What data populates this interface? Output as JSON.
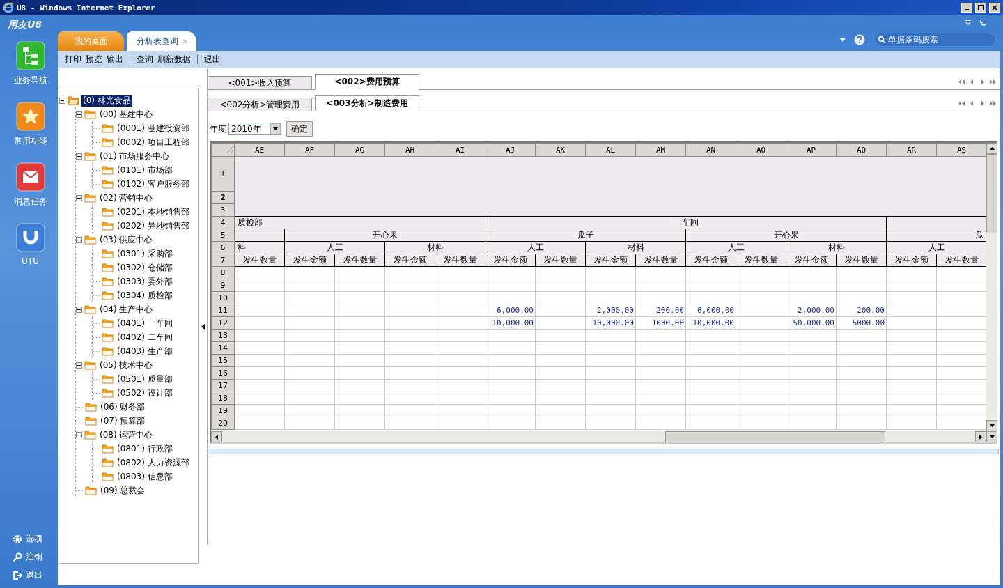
{
  "window": {
    "title": "U8 - Windows Internet Explorer"
  },
  "app": {
    "logo": "用友U8"
  },
  "nav": [
    {
      "label": "业务导航",
      "kind": "navigation"
    },
    {
      "label": "常用功能",
      "kind": "favorites"
    },
    {
      "label": "消息任务",
      "kind": "messages"
    },
    {
      "label": "UTU",
      "kind": "utu"
    }
  ],
  "nav_footer": [
    {
      "label": "选项",
      "kind": "options"
    },
    {
      "label": "注销",
      "kind": "logout"
    },
    {
      "label": "退出",
      "kind": "exit"
    }
  ],
  "page_tabs": [
    {
      "label": "我的桌面",
      "selected": false,
      "closable": false
    },
    {
      "label": "分析表查询",
      "selected": true,
      "closable": true
    }
  ],
  "search": {
    "placeholder": "单据条码搜索"
  },
  "toolbar": [
    [
      "打印",
      "预览",
      "输出"
    ],
    [
      "查询",
      "刷新数据"
    ],
    [
      "退出"
    ]
  ],
  "tree": {
    "label": "(0) 林光食品",
    "selected": true,
    "expanded": true,
    "children": [
      {
        "label": "(00) 基建中心",
        "selected": false,
        "expanded": true,
        "children": [
          {
            "label": "(0001) 基建投资部",
            "selected": false
          },
          {
            "label": "(0002) 项目工程部",
            "selected": false
          }
        ]
      },
      {
        "label": "(01) 市场服务中心",
        "selected": false,
        "expanded": true,
        "children": [
          {
            "label": "(0101) 市场部",
            "selected": false
          },
          {
            "label": "(0102) 客户服务部",
            "selected": false
          }
        ]
      },
      {
        "label": "(02) 营销中心",
        "selected": false,
        "expanded": true,
        "children": [
          {
            "label": "(0201) 本地销售部",
            "selected": false
          },
          {
            "label": "(0202) 异地销售部",
            "selected": false
          }
        ]
      },
      {
        "label": "(03) 供应中心",
        "selected": false,
        "expanded": true,
        "children": [
          {
            "label": "(0301) 采购部",
            "selected": false
          },
          {
            "label": "(0302) 仓储部",
            "selected": false
          },
          {
            "label": "(0303) 委外部",
            "selected": false
          },
          {
            "label": "(0304) 质检部",
            "selected": false
          }
        ]
      },
      {
        "label": "(04) 生产中心",
        "selected": false,
        "expanded": true,
        "children": [
          {
            "label": "(0401) 一车间",
            "selected": false
          },
          {
            "label": "(0402) 二车间",
            "selected": false
          },
          {
            "label": "(0403) 生产部",
            "selected": false
          }
        ]
      },
      {
        "label": "(05) 技术中心",
        "selected": false,
        "expanded": true,
        "children": [
          {
            "label": "(0501) 质量部",
            "selected": false
          },
          {
            "label": "(0502) 设计部",
            "selected": false
          }
        ]
      },
      {
        "label": "(06) 财务部",
        "selected": false
      },
      {
        "label": "(07) 预算部",
        "selected": false
      },
      {
        "label": "(08) 运营中心",
        "selected": false,
        "expanded": true,
        "children": [
          {
            "label": "(0801) 行政部",
            "selected": false
          },
          {
            "label": "(0802) 人力资源部",
            "selected": false
          },
          {
            "label": "(0803) 信息部",
            "selected": false
          }
        ]
      },
      {
        "label": "(09) 总裁会",
        "selected": false
      }
    ]
  },
  "report_tabs": [
    {
      "label": "<001>收入预算",
      "selected": false
    },
    {
      "label": "<002>费用预算",
      "selected": true
    }
  ],
  "analysis_tabs": [
    {
      "label": "<002分析>管理费用",
      "selected": false
    },
    {
      "label": "<003分析>制造费用",
      "selected": true
    }
  ],
  "year": {
    "label": "年度",
    "value": "2010年"
  },
  "confirm_button": "确定",
  "sheet": {
    "columns": [
      "AE",
      "AF",
      "AG",
      "AH",
      "AI",
      "AJ",
      "AK",
      "AL",
      "AM",
      "AN",
      "AO",
      "AP",
      "AQ",
      "AR",
      "AS"
    ],
    "row_headers": [
      {
        "label": "1",
        "selected": false
      },
      {
        "label": "2",
        "selected": true
      },
      {
        "label": "3",
        "selected": false
      },
      {
        "label": "4",
        "selected": false
      },
      {
        "label": "5",
        "selected": false
      },
      {
        "label": "6",
        "selected": false
      },
      {
        "label": "7",
        "selected": false
      },
      {
        "label": "8",
        "selected": false
      },
      {
        "label": "9",
        "selected": false
      },
      {
        "label": "10",
        "selected": false
      },
      {
        "label": "11",
        "selected": false
      },
      {
        "label": "12",
        "selected": false
      },
      {
        "label": "13",
        "selected": false
      },
      {
        "label": "14",
        "selected": false
      },
      {
        "label": "15",
        "selected": false
      },
      {
        "label": "16",
        "selected": false
      },
      {
        "label": "17",
        "selected": false
      },
      {
        "label": "18",
        "selected": false
      },
      {
        "label": "19",
        "selected": false
      },
      {
        "label": "20",
        "selected": false
      }
    ],
    "header_tree": [
      {
        "text": "质检部",
        "kind": "left",
        "children": [
          {
            "children": [
              {
                "text": "料",
                "kind": "left",
                "children": [
                  {
                    "text": "发生数量"
                  }
                ]
              }
            ]
          },
          {
            "text": "开心果",
            "children": [
              {
                "text": "人工",
                "children": [
                  {
                    "text": "发生金额"
                  },
                  {
                    "text": "发生数量"
                  }
                ]
              },
              {
                "text": "材料",
                "children": [
                  {
                    "text": "发生金额"
                  },
                  {
                    "text": "发生数量"
                  }
                ]
              }
            ]
          }
        ]
      },
      {
        "text": "一车间",
        "children": [
          {
            "text": "瓜子",
            "children": [
              {
                "text": "人工",
                "children": [
                  {
                    "text": "发生金额"
                  },
                  {
                    "text": "发生数量"
                  }
                ]
              },
              {
                "text": "材料",
                "children": [
                  {
                    "text": "发生金额"
                  },
                  {
                    "text": "发生数量"
                  }
                ]
              }
            ]
          },
          {
            "text": "开心果",
            "children": [
              {
                "text": "人工",
                "children": [
                  {
                    "text": "发生金额"
                  },
                  {
                    "text": "发生数量"
                  }
                ]
              },
              {
                "text": "材料",
                "children": [
                  {
                    "text": "发生金额"
                  },
                  {
                    "text": "发生数量"
                  }
                ]
              }
            ]
          }
        ]
      },
      {
        "children": [
          {
            "text": "瓜",
            "kind": "right",
            "children": [
              {
                "text": "人工",
                "children": [
                  {
                    "text": "发生金额"
                  },
                  {
                    "text": "发生数量"
                  }
                ]
              }
            ]
          }
        ]
      }
    ],
    "data_rows": [
      {
        "cells": [
          {},
          {},
          {},
          {},
          {},
          {},
          {},
          {},
          {},
          {},
          {},
          {},
          {},
          {},
          {}
        ]
      },
      {
        "cells": [
          {},
          {},
          {},
          {},
          {},
          {},
          {},
          {},
          {},
          {},
          {},
          {},
          {},
          {},
          {}
        ]
      },
      {
        "cells": [
          {},
          {},
          {},
          {},
          {},
          {},
          {},
          {},
          {},
          {},
          {},
          {},
          {},
          {},
          {}
        ]
      },
      {
        "cells": [
          {},
          {},
          {},
          {},
          {},
          {
            "text": "6,000.00"
          },
          {},
          {
            "text": "2,000.00"
          },
          {
            "text": "200.00"
          },
          {
            "text": "6,000.00"
          },
          {},
          {
            "text": "2,000.00"
          },
          {
            "text": "200.00"
          },
          {},
          {}
        ]
      },
      {
        "cells": [
          {},
          {},
          {},
          {},
          {},
          {
            "text": "10,000.00"
          },
          {},
          {
            "text": "10,000.00"
          },
          {
            "text": "1000.00"
          },
          {
            "text": "10,000.00"
          },
          {},
          {
            "text": "50,000.00"
          },
          {
            "text": "5000.00"
          },
          {},
          {}
        ]
      },
      {
        "cells": [
          {},
          {},
          {},
          {},
          {},
          {},
          {},
          {},
          {},
          {},
          {},
          {},
          {},
          {},
          {}
        ]
      },
      {
        "cells": [
          {},
          {},
          {},
          {},
          {},
          {},
          {},
          {},
          {},
          {},
          {},
          {},
          {},
          {},
          {}
        ]
      },
      {
        "cells": [
          {},
          {},
          {},
          {},
          {},
          {},
          {},
          {},
          {},
          {},
          {},
          {},
          {},
          {},
          {}
        ]
      },
      {
        "cells": [
          {},
          {},
          {},
          {},
          {},
          {},
          {},
          {},
          {},
          {},
          {},
          {},
          {},
          {},
          {}
        ]
      },
      {
        "cells": [
          {},
          {},
          {},
          {},
          {},
          {},
          {},
          {},
          {},
          {},
          {},
          {},
          {},
          {},
          {}
        ]
      },
      {
        "cells": [
          {},
          {},
          {},
          {},
          {},
          {},
          {},
          {},
          {},
          {},
          {},
          {},
          {},
          {},
          {}
        ]
      },
      {
        "cells": [
          {},
          {},
          {},
          {},
          {},
          {},
          {},
          {},
          {},
          {},
          {},
          {},
          {},
          {},
          {}
        ]
      },
      {
        "cells": [
          {},
          {},
          {},
          {},
          {},
          {},
          {},
          {},
          {},
          {},
          {},
          {},
          {},
          {},
          {}
        ]
      }
    ]
  }
}
